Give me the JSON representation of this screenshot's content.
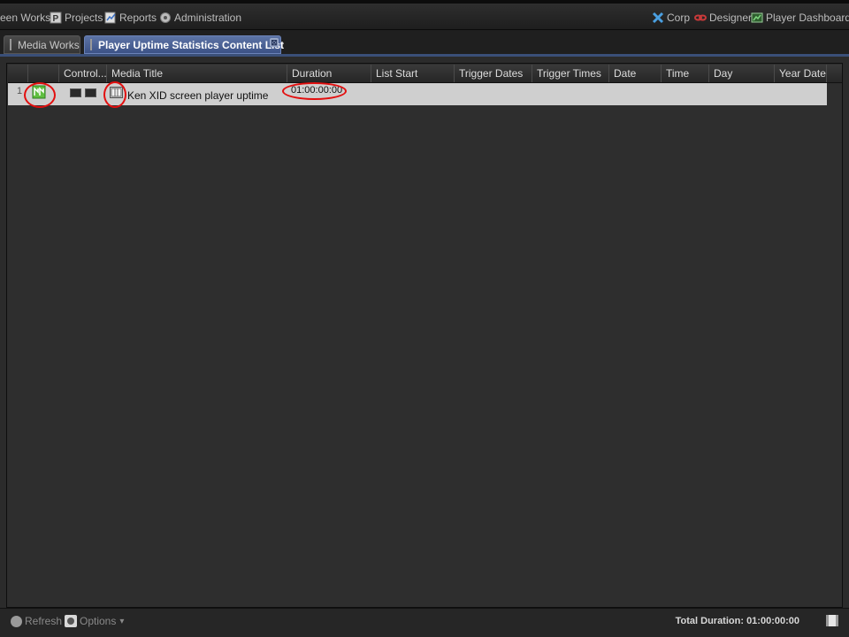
{
  "topbar": {
    "left_items": [
      {
        "label": "een Works",
        "icon": "none"
      },
      {
        "label": "Projects",
        "icon": "projects-icon"
      },
      {
        "label": "Reports",
        "icon": "reports-icon"
      },
      {
        "label": "Administration",
        "icon": "admin-icon"
      }
    ],
    "right_items": [
      {
        "label": "Corp",
        "icon": "corp-icon",
        "color": "#4a9fe0"
      },
      {
        "label": "Designer",
        "icon": "designer-icon",
        "color": "#c83a3a"
      },
      {
        "label": "Player Dashboard",
        "icon": "dashboard-icon",
        "color": "#4caf50"
      }
    ]
  },
  "tabs": [
    {
      "label": "Media Works",
      "active": false
    },
    {
      "label": "Player Uptime Statistics Content List",
      "active": true,
      "close": "⊠"
    }
  ],
  "grid": {
    "columns": [
      "",
      "",
      "Control...",
      "Media Title",
      "Duration",
      "List Start",
      "Trigger Dates",
      "Trigger Times",
      "Date",
      "Time",
      "Day",
      "Year Date"
    ],
    "rows": [
      {
        "row_number": "1",
        "status_icon": "schedule-status-icon",
        "controls": [
          "player-control-icon",
          "video-control-icon"
        ],
        "media_icon": "media-content-icon",
        "media_title": "Ken XID screen player uptime",
        "duration": "01:00:00:00",
        "list_start": "",
        "trigger_dates": "",
        "trigger_times": "",
        "date": "",
        "time": "",
        "day": "",
        "year_date": ""
      }
    ]
  },
  "annotation_color": "#e30f0f",
  "bottombar": {
    "refresh_label": "Refresh",
    "options_label": "Options",
    "options_arrow": "▾",
    "total_duration": "Total Duration: 01:00:00:00"
  }
}
